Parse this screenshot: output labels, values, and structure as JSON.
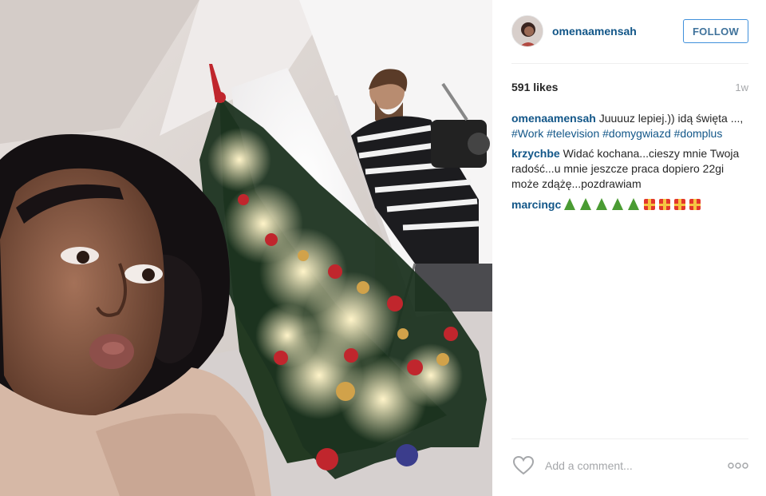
{
  "post": {
    "username": "omenaamensah",
    "follow_label": "FOLLOW",
    "likes": "591 likes",
    "time_ago": "1w",
    "caption": {
      "user": "omenaamensah",
      "text": " Juuuuz lepiej.)) idą święta ..., ",
      "tags": [
        "#Work",
        "#television",
        "#domygwiazd",
        "#domplus"
      ]
    },
    "comments": [
      {
        "user": "krzychbe",
        "text": " Widać kochana...cieszy mnie Twoja radość...u mnie jeszcze praca dopiero 22gi może zdążę...pozdrawiam"
      },
      {
        "user": "marcingc",
        "emoji": [
          "christmas-tree",
          "christmas-tree",
          "christmas-tree",
          "christmas-tree",
          "christmas-tree",
          "gift",
          "gift",
          "gift",
          "gift"
        ]
      }
    ],
    "add_comment_placeholder": "Add a comment...",
    "icons": {
      "like": "heart-outline-icon",
      "more": "more-options-icon"
    },
    "colors": {
      "link": "#125688",
      "follow_border": "#4090db",
      "muted": "#a5a7aa",
      "tree": "#4a9b33",
      "gift": "#e3372b"
    }
  }
}
